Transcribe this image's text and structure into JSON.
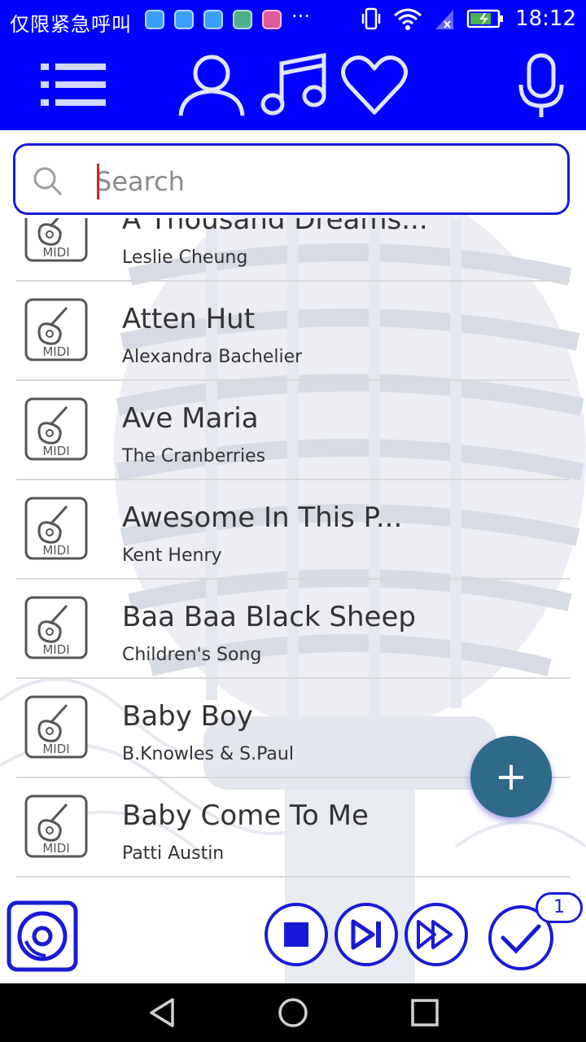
{
  "status_bar": {
    "carrier_text": "仅限紧急呼叫",
    "overflow": "···",
    "time": "18:12",
    "icons": [
      "android-icon",
      "shield-icon",
      "shield-icon",
      "grid-icon",
      "app-icon",
      "vibrate-icon",
      "wifi-icon",
      "signal-icon",
      "battery-icon"
    ]
  },
  "toolbar": {
    "icons": [
      "menu-icon",
      "artist-icon",
      "music-note-icon",
      "favorite-icon",
      "microphone-icon"
    ],
    "color": "#0000ff"
  },
  "search": {
    "placeholder": "Search",
    "value": ""
  },
  "songs": [
    {
      "title": "A Thousand Dreams...",
      "artist": "Leslie Cheung",
      "badge": "MIDI"
    },
    {
      "title": "Atten Hut",
      "artist": "Alexandra Bachelier",
      "badge": "MIDI"
    },
    {
      "title": "Ave Maria",
      "artist": "The Cranberries",
      "badge": "MIDI"
    },
    {
      "title": "Awesome In This P...",
      "artist": "Kent Henry",
      "badge": "MIDI"
    },
    {
      "title": "Baa Baa Black Sheep",
      "artist": "Children's Song",
      "badge": "MIDI"
    },
    {
      "title": "Baby Boy",
      "artist": "B.Knowles & S.Paul",
      "badge": "MIDI"
    },
    {
      "title": "Baby Come To Me",
      "artist": "Patti Austin",
      "badge": "MIDI"
    }
  ],
  "fab": {
    "label": "+"
  },
  "player": {
    "icons": [
      "disc-icon",
      "stop-icon",
      "skip-next-icon",
      "fast-forward-icon",
      "check-icon"
    ],
    "selected_count": "1"
  },
  "nav": {
    "icons": [
      "back-icon",
      "home-icon",
      "recents-icon"
    ]
  },
  "colors": {
    "accent": "#0000ff",
    "fab": "#2f6a8a",
    "text": "#333333"
  }
}
